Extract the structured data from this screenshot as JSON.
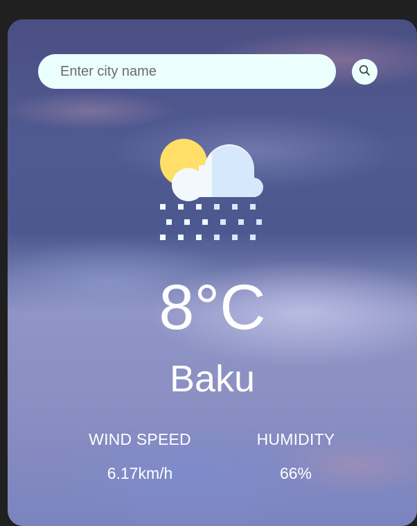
{
  "search": {
    "placeholder": "Enter city name",
    "value": "",
    "button_icon": "search-icon"
  },
  "weather": {
    "icon": "snow-cloud-sun-icon",
    "temperature": "8°C",
    "city": "Baku"
  },
  "details": {
    "wind_label": "WIND SPEED",
    "wind_value": "6.17km/h",
    "humidity_label": "HUMIDITY",
    "humidity_value": "66%"
  },
  "colors": {
    "background": "#202020",
    "search_bg": "#ebfffc",
    "text": "#ffffff",
    "sun": "#ffdf67",
    "cloud_light": "#f2f8fc",
    "cloud_shade": "#d6e8fb"
  }
}
